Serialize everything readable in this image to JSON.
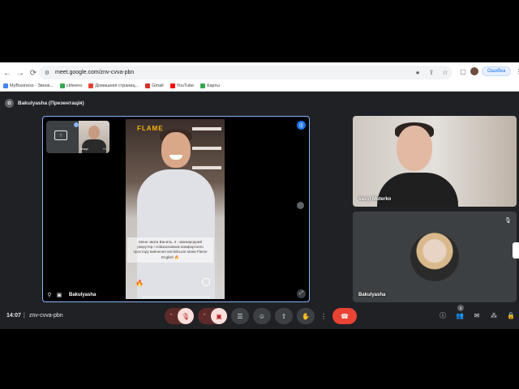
{
  "browser": {
    "url": "meet.google.com/znv-cvva-pbn",
    "error_label": "Ошибка",
    "bookmarks": [
      {
        "label": "MyBusiness - Звонк...",
        "color": "#4285f4"
      },
      {
        "label": "clrteeno",
        "color": "#34a853"
      },
      {
        "label": "Домашняя страниц...",
        "color": "#ea4335"
      },
      {
        "label": "Gmail",
        "color": "#d93025"
      },
      {
        "label": "YouTube",
        "color": "#ff0000"
      },
      {
        "label": "Карты",
        "color": "#34a853"
      }
    ]
  },
  "meet": {
    "presentation_title": "Bakulyasha (Презентація)",
    "presenter_name": "Bakulyasha",
    "pip_name": "Vasyl",
    "pip_plus": "+1",
    "reel": {
      "logo": "FLAME",
      "caption": "Мене звати Василь, я - міжнародний рекрутер і співзасновник комфортного простору вивчення англійської мови Flame English 🔥"
    },
    "participants": [
      {
        "name": "Vasyl Muterko"
      },
      {
        "name": "Bakulyasha"
      }
    ],
    "controls": {
      "time": "14:07",
      "separator": "|",
      "meeting_code": "znv-cvva-pbn",
      "people_count": "3"
    },
    "colors": {
      "accent": "#8ab4f8",
      "hangup": "#ea4335",
      "background": "#202124"
    }
  }
}
